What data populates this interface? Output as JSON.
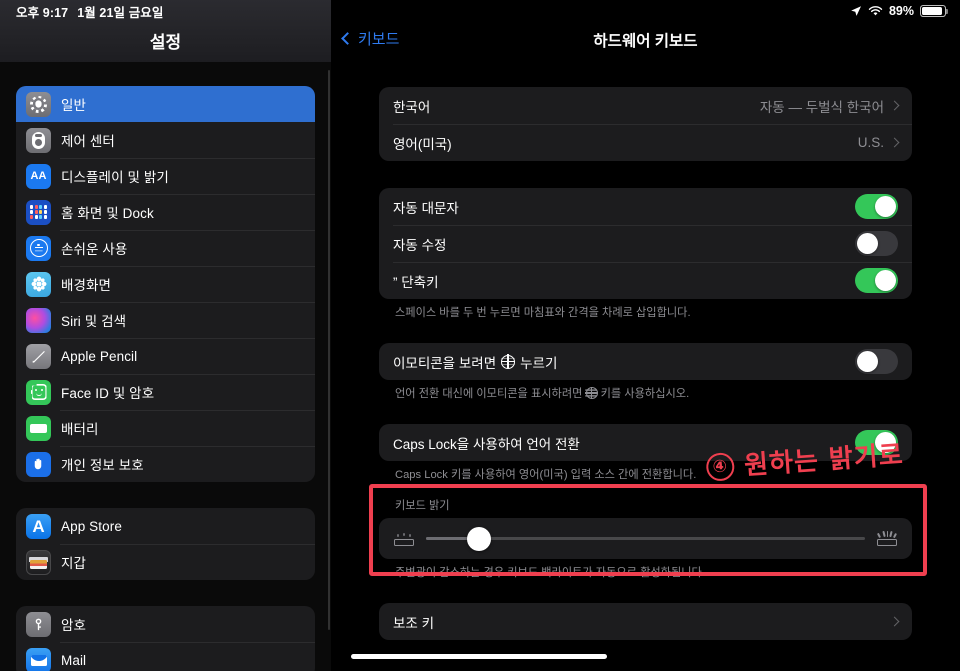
{
  "statusbar": {
    "time": "오후 9:17",
    "date": "1월 21일 금요일",
    "battery_percent": "89%",
    "location_icon": "location-arrow-icon",
    "wifi_icon": "wifi-icon",
    "battery_icon": "battery-icon"
  },
  "sidebar": {
    "title": "설정",
    "groups": [
      {
        "items": [
          {
            "label": "일반",
            "icon": "gear-icon",
            "selected": true
          },
          {
            "label": "제어 센터",
            "icon": "control-center-icon",
            "selected": false
          },
          {
            "label": "디스플레이 및 밝기",
            "icon": "display-brightness-icon",
            "selected": false
          },
          {
            "label": "홈 화면 및 Dock",
            "icon": "home-screen-dock-icon",
            "selected": false
          },
          {
            "label": "손쉬운 사용",
            "icon": "accessibility-icon",
            "selected": false
          },
          {
            "label": "배경화면",
            "icon": "wallpaper-icon",
            "selected": false
          },
          {
            "label": "Siri 및 검색",
            "icon": "siri-icon",
            "selected": false
          },
          {
            "label": "Apple Pencil",
            "icon": "apple-pencil-icon",
            "selected": false
          },
          {
            "label": "Face ID 및 암호",
            "icon": "face-id-icon",
            "selected": false
          },
          {
            "label": "배터리",
            "icon": "battery-settings-icon",
            "selected": false
          },
          {
            "label": "개인 정보 보호",
            "icon": "privacy-hand-icon",
            "selected": false
          }
        ]
      },
      {
        "items": [
          {
            "label": "App Store",
            "icon": "app-store-icon",
            "selected": false
          },
          {
            "label": "지갑",
            "icon": "wallet-icon",
            "selected": false
          }
        ]
      },
      {
        "items": [
          {
            "label": "암호",
            "icon": "passwords-key-icon",
            "selected": false
          },
          {
            "label": "Mail",
            "icon": "mail-icon",
            "selected": false
          }
        ]
      }
    ]
  },
  "detail": {
    "back_label": "키보드",
    "title": "하드웨어 키보드",
    "language_group": [
      {
        "label": "한국어",
        "value": "자동 — 두벌식 한국어"
      },
      {
        "label": "영어(미국)",
        "value": "U.S."
      }
    ],
    "typing_group": [
      {
        "label": "자동 대문자",
        "state": "on"
      },
      {
        "label": "자동 수정",
        "state": "off"
      },
      {
        "label": "” 단축키",
        "state": "on"
      }
    ],
    "typing_footnote": "스페이스 바를 두 번 누르면 마침표와 간격을 차례로 삽입합니다.",
    "emoji_row": {
      "label_before": "이모티콘을 보려면",
      "label_after": "누르기",
      "state": "off"
    },
    "emoji_footnote_before": "언어 전환 대신에 이모티콘을 표시하려면",
    "emoji_footnote_after": "키를 사용하십시오.",
    "capslock_row": {
      "label": "Caps Lock을 사용하여 언어 전환",
      "state": "on"
    },
    "capslock_footnote": "Caps Lock 키를 사용하여 영어(미국) 입력 소스 간에 전환합니다.",
    "brightness": {
      "caption": "키보드 밝기",
      "value_percent": 12,
      "low_icon": "keyboard-brightness-low-icon",
      "high_icon": "keyboard-brightness-high-icon",
      "footnote": "주변광이 감소하는 경우 키보드 백라이트가 자동으로 활성화됩니다."
    },
    "modifier_row": {
      "label": "보조 키"
    }
  },
  "annotation": {
    "number": "④",
    "text": "원하는 밝기로",
    "color": "#ef3f4f"
  }
}
